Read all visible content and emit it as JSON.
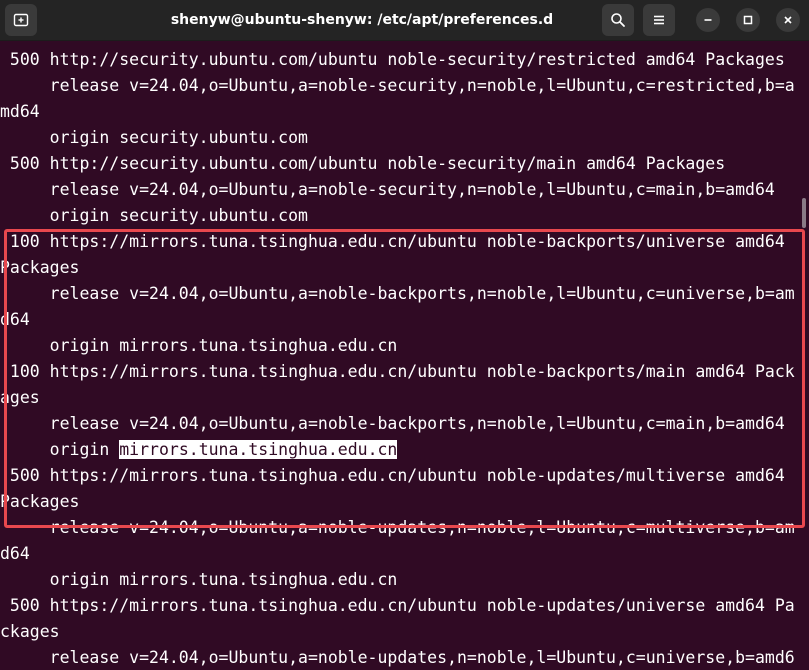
{
  "window": {
    "title": "shenyw@ubuntu-shenyw: /etc/apt/preferences.d"
  },
  "icons": {
    "new_tab": "new-tab-icon",
    "search": "search-icon",
    "menu": "hamburger-menu-icon",
    "minimize": "minimize-icon",
    "maximize": "maximize-icon",
    "close": "close-icon"
  },
  "colors": {
    "terminal_bg": "#300a24",
    "titlebar_bg": "#242424",
    "highlight_border": "#e8484e"
  },
  "terminal": {
    "lines": [
      " 500 http://security.ubuntu.com/ubuntu noble-security/restricted amd64 Packages",
      "     release v=24.04,o=Ubuntu,a=noble-security,n=noble,l=Ubuntu,c=restricted,b=a",
      "md64",
      "     origin security.ubuntu.com",
      " 500 http://security.ubuntu.com/ubuntu noble-security/main amd64 Packages",
      "     release v=24.04,o=Ubuntu,a=noble-security,n=noble,l=Ubuntu,c=main,b=amd64",
      "     origin security.ubuntu.com",
      " 100 https://mirrors.tuna.tsinghua.edu.cn/ubuntu noble-backports/universe amd64",
      "Packages",
      "     release v=24.04,o=Ubuntu,a=noble-backports,n=noble,l=Ubuntu,c=universe,b=am",
      "d64",
      "     origin mirrors.tuna.tsinghua.edu.cn",
      " 100 https://mirrors.tuna.tsinghua.edu.cn/ubuntu noble-backports/main amd64 Pack",
      "ages",
      "     release v=24.04,o=Ubuntu,a=noble-backports,n=noble,l=Ubuntu,c=main,b=amd64"
    ],
    "selected_line": {
      "prefix": "     origin ",
      "selected": "mirrors.tuna.tsinghua.edu.cn"
    },
    "lines_after": [
      " 500 https://mirrors.tuna.tsinghua.edu.cn/ubuntu noble-updates/multiverse amd64",
      "Packages",
      "     release v=24.04,o=Ubuntu,a=noble-updates,n=noble,l=Ubuntu,c=multiverse,b=am",
      "d64",
      "     origin mirrors.tuna.tsinghua.edu.cn",
      " 500 https://mirrors.tuna.tsinghua.edu.cn/ubuntu noble-updates/universe amd64 Pa",
      "ckages",
      "     release v=24.04,o=Ubuntu,a=noble-updates,n=noble,l=Ubuntu,c=universe,b=amd6"
    ]
  }
}
